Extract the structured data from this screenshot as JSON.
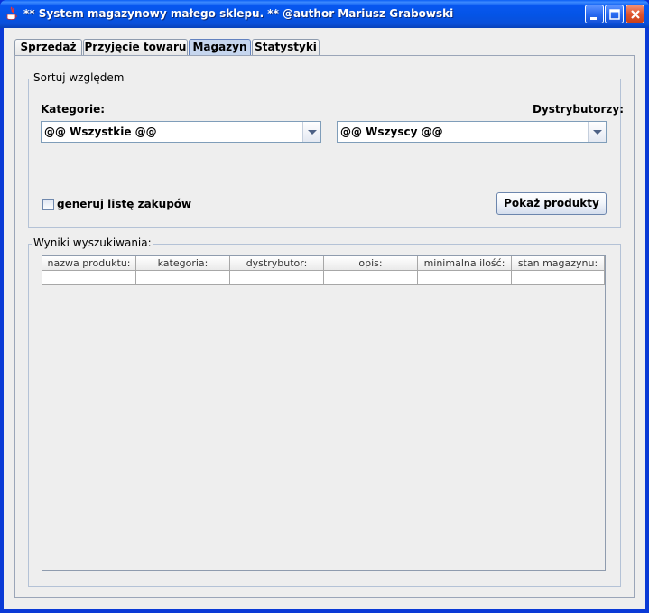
{
  "window": {
    "title": "** System magazynowy małego sklepu. ** @author Mariusz Grabowski"
  },
  "tabs": [
    {
      "label": "Sprzedaż"
    },
    {
      "label": "Przyjęcie towaru"
    },
    {
      "label": "Magazyn",
      "active": true
    },
    {
      "label": "Statystyki"
    }
  ],
  "sort_group": {
    "title": "Sortuj względem",
    "category_label": "Kategorie:",
    "category_value": "@@ Wszystkie @@",
    "distributor_label": "Dystrybutorzy:",
    "distributor_value": "@@ Wszyscy @@",
    "checkbox_label": "generuj listę zakupów",
    "checkbox_checked": false,
    "show_button": "Pokaż produkty"
  },
  "results_group": {
    "title": "Wyniki wyszukiwania:",
    "columns": [
      "nazwa produktu:",
      "kategoria:",
      "dystrybutor:",
      "opis:",
      "minimalna ilość:",
      "stan magazynu:"
    ]
  },
  "colors": {
    "titlebar": "#0454e6",
    "active_tab": "#c6d6ee",
    "panel_bg": "#eeeeee"
  }
}
